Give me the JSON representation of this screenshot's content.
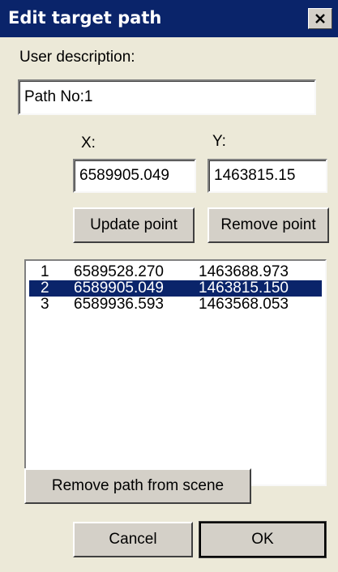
{
  "window": {
    "title": "Edit target path",
    "close_icon": "close-icon",
    "close_glyph": "✕"
  },
  "form": {
    "description_label": "User description:",
    "description_value": "Path No:1",
    "x_label": "X:",
    "y_label": "Y:",
    "x_value": "6589905.049",
    "y_value": "1463815.15"
  },
  "buttons": {
    "update_point": "Update point",
    "remove_point": "Remove point",
    "remove_path": "Remove path from scene",
    "cancel": "Cancel",
    "ok": "OK"
  },
  "points": [
    {
      "index": "1",
      "x": "6589528.270",
      "y": "1463688.973",
      "selected": false
    },
    {
      "index": "2",
      "x": "6589905.049",
      "y": "1463815.150",
      "selected": true
    },
    {
      "index": "3",
      "x": "6589936.593",
      "y": "1463568.053",
      "selected": false
    }
  ],
  "colors": {
    "titlebar": "#0a246a",
    "dialog_bg": "#ece9d8",
    "selection": "#0a246a"
  }
}
